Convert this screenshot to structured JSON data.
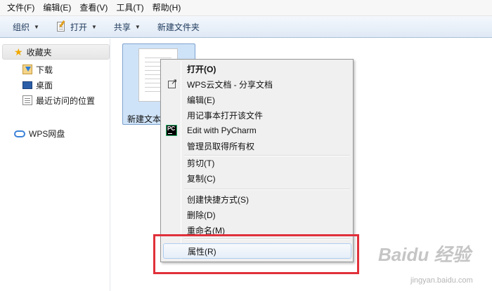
{
  "menubar": {
    "items": [
      "文件(F)",
      "编辑(E)",
      "查看(V)",
      "工具(T)",
      "帮助(H)"
    ]
  },
  "toolbar": {
    "organize": "组织",
    "open": "打开",
    "share": "共享",
    "new_folder": "新建文件夹"
  },
  "sidebar": {
    "favorites": "收藏夹",
    "items": [
      "下载",
      "桌面",
      "最近访问的位置"
    ],
    "wps_drive": "WPS网盘"
  },
  "file": {
    "name": "新建文本"
  },
  "context_menu": {
    "items": [
      {
        "label": "打开(O)",
        "icon": "none"
      },
      {
        "label": "WPS云文档 - 分享文档",
        "icon": "share-icon"
      },
      {
        "label": "编辑(E)",
        "icon": "none"
      },
      {
        "label": "用记事本打开该文件",
        "icon": "none"
      },
      {
        "label": "Edit with PyCharm",
        "icon": "pycharm-icon"
      },
      {
        "label": "管理员取得所有权",
        "icon": "none"
      },
      {
        "label": "剪切(T)",
        "icon": "none"
      },
      {
        "label": "复制(C)",
        "icon": "none"
      },
      {
        "label": "创建快捷方式(S)",
        "icon": "none"
      },
      {
        "label": "删除(D)",
        "icon": "none"
      },
      {
        "label": "重命名(M)",
        "icon": "none"
      },
      {
        "label": "属性(R)",
        "icon": "none"
      }
    ]
  },
  "watermark": {
    "logo": "Baidu 经验",
    "url": "jingyan.baidu.com"
  },
  "colors": {
    "highlight_border": "#e0303a",
    "hover_border": "#aecdf1",
    "selection_bg": "#cfe3f8"
  }
}
